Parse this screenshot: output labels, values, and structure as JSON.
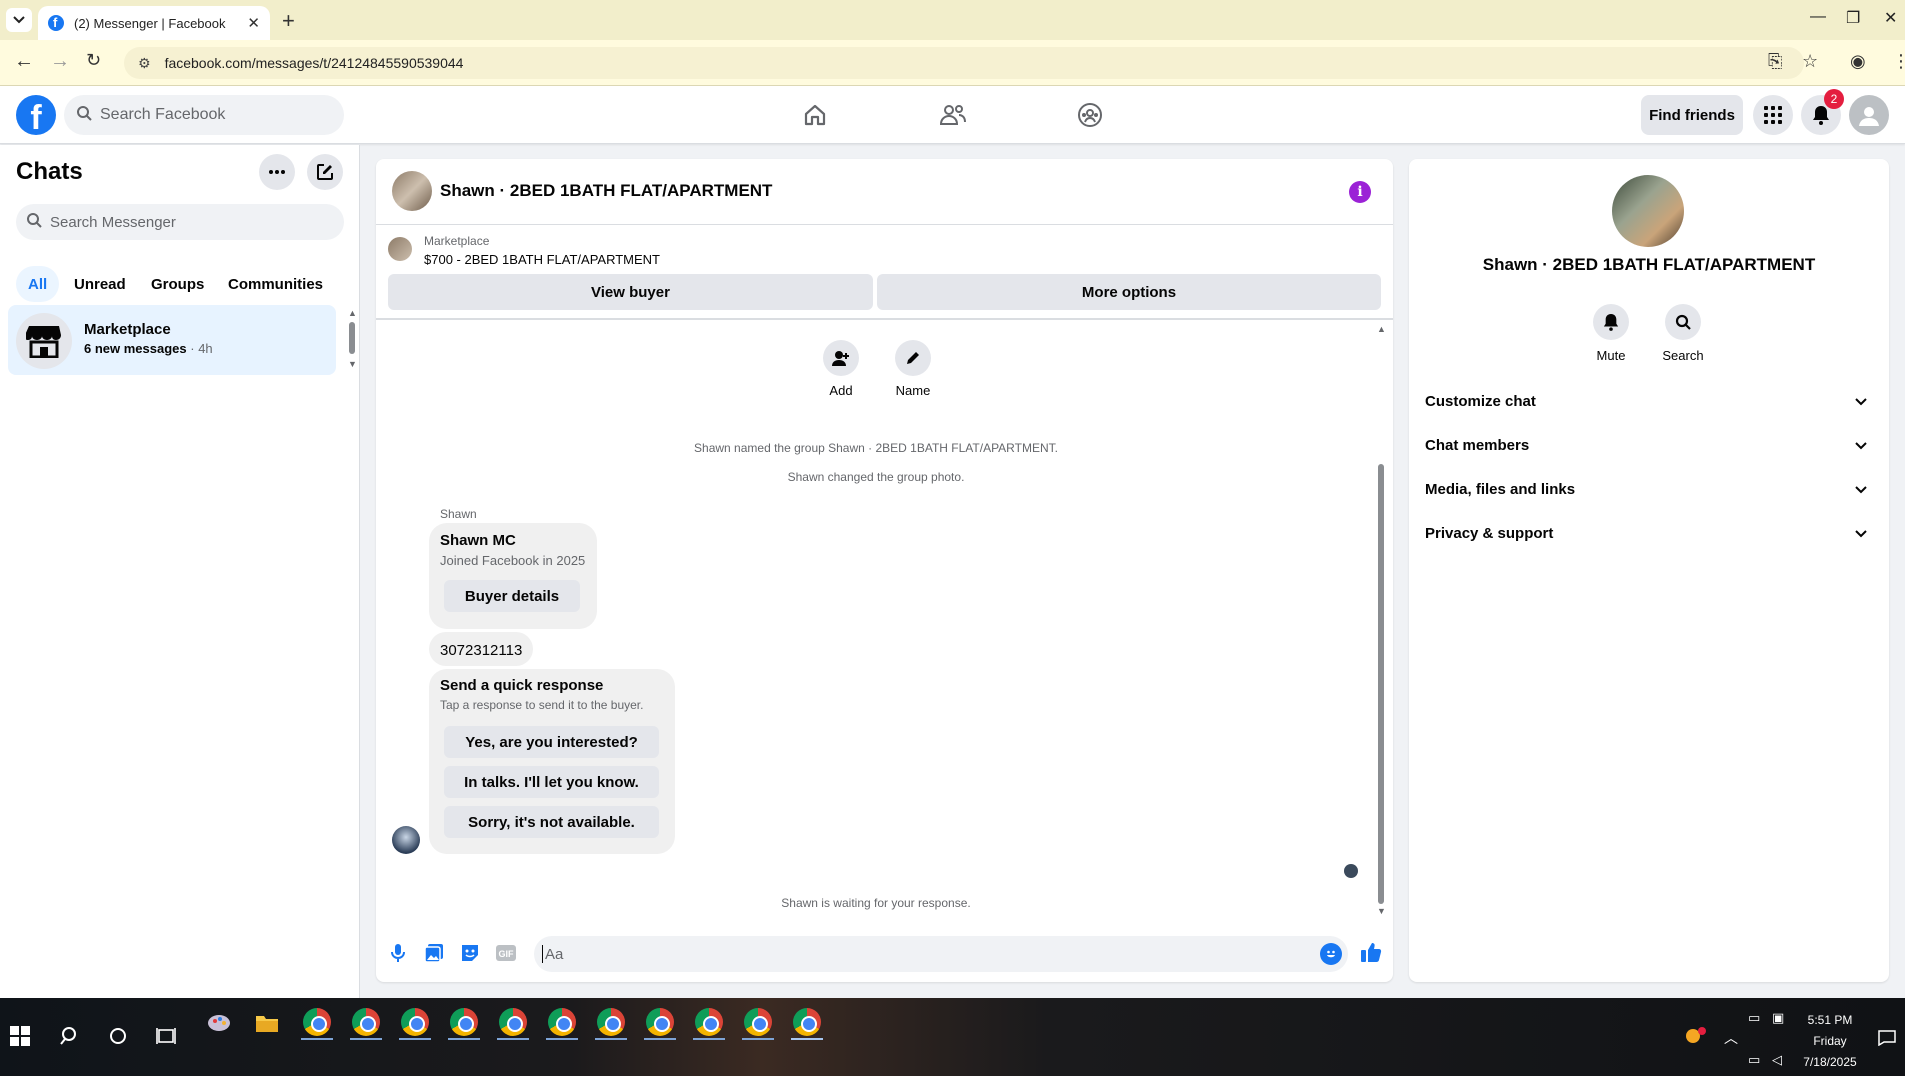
{
  "browser": {
    "tab_title": "(2) Messenger | Facebook",
    "url": "facebook.com/messages/t/24124845590539044"
  },
  "header": {
    "search_placeholder": "Search Facebook",
    "find_friends": "Find friends",
    "notification_count": "2"
  },
  "sidebar": {
    "title": "Chats",
    "search_placeholder": "Search Messenger",
    "filters": [
      "All",
      "Unread",
      "Groups",
      "Communities"
    ],
    "active_filter": "All",
    "chats": [
      {
        "name": "Marketplace",
        "preview": "6 new messages",
        "time": "4h"
      }
    ]
  },
  "conversation": {
    "title": "Shawn · 2BED 1BATH FLAT/APARTMENT",
    "marketplace_label": "Marketplace",
    "listing": "$700 - 2BED 1BATH FLAT/APARTMENT",
    "view_buyer": "View buyer",
    "more_options": "More options",
    "actions": [
      {
        "label": "Add",
        "icon": "add-person-icon"
      },
      {
        "label": "Name",
        "icon": "pencil-icon"
      }
    ],
    "system_messages": [
      "Shawn named the group Shawn · 2BED 1BATH FLAT/APARTMENT.",
      "Shawn changed the group photo."
    ],
    "sender": "Shawn",
    "profile_card": {
      "name": "Shawn MC",
      "joined": "Joined Facebook in 2025",
      "button": "Buyer details"
    },
    "phone_message": "3072312113",
    "quick_response": {
      "title": "Send a quick response",
      "subtitle": "Tap a response to send it to the buyer.",
      "options": [
        "Yes, are you interested?",
        "In talks. I'll let you know.",
        "Sorry, it's not available."
      ]
    },
    "waiting": "Shawn is waiting for your response.",
    "composer_placeholder": "Aa"
  },
  "info_panel": {
    "name": "Shawn · 2BED 1BATH FLAT/APARTMENT",
    "actions": [
      {
        "label": "Mute",
        "icon": "bell-icon"
      },
      {
        "label": "Search",
        "icon": "search-icon"
      }
    ],
    "sections": [
      "Customize chat",
      "Chat members",
      "Media, files and links",
      "Privacy & support"
    ]
  },
  "taskbar": {
    "time": "5:51 PM",
    "day": "Friday",
    "date": "7/18/2025"
  },
  "colors": {
    "accent": "#1877f2",
    "info": "#9b22d6",
    "badge": "#e41e3f"
  }
}
